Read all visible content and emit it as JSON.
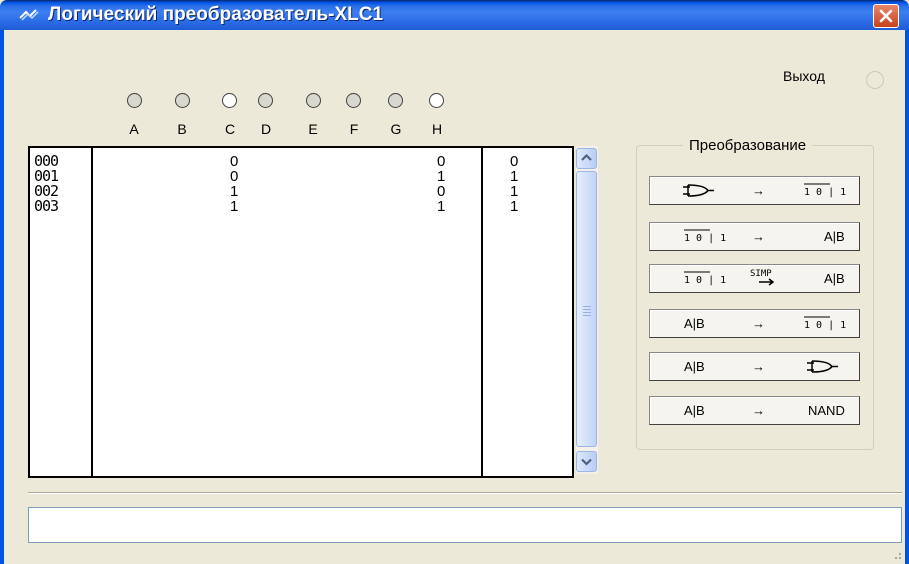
{
  "window": {
    "title": "Логический преобразователь-XLC1",
    "close_icon": "close-icon",
    "accent_color": "#0054e3",
    "close_color": "#c7401a"
  },
  "output": {
    "label": "Выход"
  },
  "variables": [
    {
      "name": "A",
      "state": "filled"
    },
    {
      "name": "B",
      "state": "filled"
    },
    {
      "name": "C",
      "state": "hollow"
    },
    {
      "name": "D",
      "state": "filled"
    },
    {
      "name": "E",
      "state": "filled"
    },
    {
      "name": "F",
      "state": "filled"
    },
    {
      "name": "G",
      "state": "filled"
    },
    {
      "name": "H",
      "state": "hollow"
    }
  ],
  "truth_table": {
    "rows": [
      {
        "index": "000",
        "C": "0",
        "H": "0",
        "out": "0"
      },
      {
        "index": "001",
        "C": "0",
        "H": "1",
        "out": "1"
      },
      {
        "index": "002",
        "C": "1",
        "H": "0",
        "out": "1"
      },
      {
        "index": "003",
        "C": "1",
        "H": "1",
        "out": "1"
      }
    ]
  },
  "conversion": {
    "title": "Преобразование",
    "buttons": [
      {
        "name": "circuit-to-truth-table",
        "left": "gate-icon",
        "arrow": "→",
        "right": "1 0 | 1"
      },
      {
        "name": "truth-table-to-expression",
        "left": "1 0 | 1",
        "arrow": "→",
        "right": "A|B"
      },
      {
        "name": "truth-table-to-simplified",
        "left": "1 0 | 1",
        "arrow": "SIMP",
        "right": "A|B"
      },
      {
        "name": "expression-to-truth-table",
        "left": "A|B",
        "arrow": "→",
        "right": "1 0 | 1"
      },
      {
        "name": "expression-to-circuit",
        "left": "A|B",
        "arrow": "→",
        "right": "gate-icon"
      },
      {
        "name": "expression-to-nand",
        "left": "A|B",
        "arrow": "→",
        "right": "NAND"
      }
    ]
  },
  "status": {
    "value": ""
  }
}
